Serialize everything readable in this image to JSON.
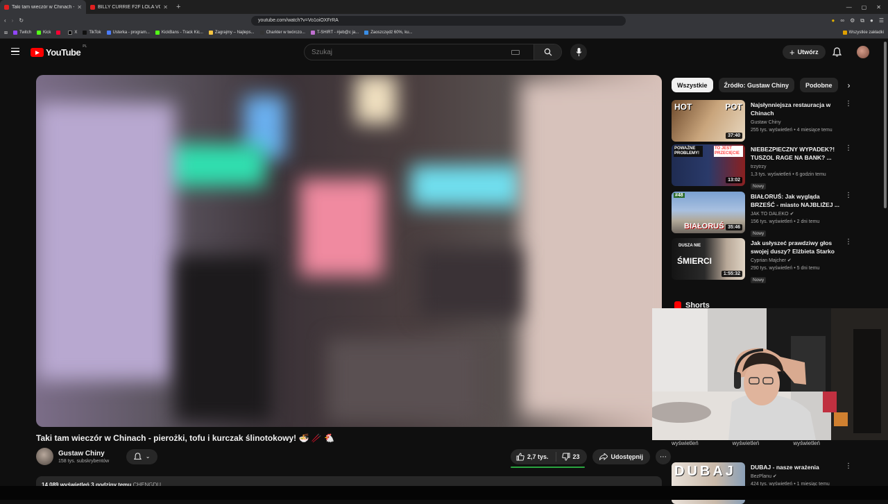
{
  "browser": {
    "tabs": [
      {
        "title": "Taki tam wieczór w Chinach -",
        "active": true
      },
      {
        "title": "BILLY CURRIE F2F LOLA VOSS | FACE",
        "active": false
      }
    ],
    "url": "youtube.com/watch?v=Vo1oiOXFrRA",
    "bookmarks": [
      "Twitch",
      "Kick",
      "",
      "X",
      "TikTok",
      "Usterka - program...",
      "KickBans - Track Kic...",
      "Zagrajmy – Najleps...",
      "Charkter w twórczo...",
      "T-SHIRT - #jeb@c ja...",
      "Zaoszczędź 60%, ku..."
    ],
    "bookmarks_right": "Wszystkie zakładki"
  },
  "header": {
    "logo_text": "YouTube",
    "country": "PL",
    "search_placeholder": "Szukaj",
    "create_label": "Utwórz"
  },
  "video": {
    "title": "Taki tam wieczór w Chinach - pierożki, tofu i kurczak ślinotokowy! 🍜 🥢 🐔",
    "channel": "Gustaw Chiny",
    "subscribers": "158 tys. subskrybentów",
    "likes": "2,7 tys.",
    "like_ratio": 0.97,
    "dislikes": "23",
    "share_label": "Udostępnij",
    "description_stats": "14 089 wyświetleń  3 godziny temu",
    "description_tag": "CHENGDU"
  },
  "chips": [
    "Wszystkie",
    "Źródło: Gustaw Chiny",
    "Podobne"
  ],
  "recommendations": [
    {
      "title": "Najsłynniejsza restauracja w Chinach",
      "channel": "Gustaw Chiny",
      "verified": false,
      "meta": "255 tys. wyświetleń • 4 miesiące temu",
      "duration": "37:40",
      "badge": "",
      "thumb_text": [
        "HOT",
        "POT"
      ],
      "color_a": "#b8895a",
      "color_b": "#d7c3a0"
    },
    {
      "title": "NIEBEZPIECZNY WYPADEK?! TUSZOL RAGE NA BANK? ...",
      "channel": "trzytrzy",
      "verified": false,
      "meta": "1,3 tys. wyświetleń • 6 godzin temu",
      "duration": "13:02",
      "badge": "Nowy",
      "thumb_text": [
        "POWAŻNE PROBLEMY!",
        "TO JEST PRZECIĘCIE"
      ],
      "color_a": "#1f2c52",
      "color_b": "#8a2020"
    },
    {
      "title": "BIAŁORUŚ: Jak wygląda BRZEŚĆ - miasto NAJBLIŻEJ ...",
      "channel": "JAK TO DALEKO",
      "verified": true,
      "meta": "156 tys. wyświetleń • 2 dni temu",
      "duration": "35:46",
      "badge": "Nowy",
      "thumb_text": [
        "BIAŁORUŚ",
        "#48"
      ],
      "color_a": "#6f8db5",
      "color_b": "#c4b8a8"
    },
    {
      "title": "Jak usłyszeć prawdziwy głos swojej duszy? Elżbieta Starko",
      "channel": "Cyprian Majcher",
      "verified": true,
      "meta": "290 tys. wyświetleń • 5 dni temu",
      "duration": "1:55:32",
      "badge": "Nowy",
      "thumb_text": [
        "DUSZA NIE",
        "ŚMIERCI"
      ],
      "color_a": "#1c1c1c",
      "color_b": "#8a7a6a"
    }
  ],
  "shorts_label": "Shorts",
  "shorts_views": [
    "wyświetleń",
    "wyświetleń",
    "wyświetleń"
  ],
  "recommendation_bottom": {
    "title": "DUBAJ - nasze wrażenia",
    "channel": "BezPlanu",
    "verified": true,
    "meta": "424 tys. wyświetleń • 1 miesiąc temu",
    "thumb_text": "DUBAJ"
  }
}
